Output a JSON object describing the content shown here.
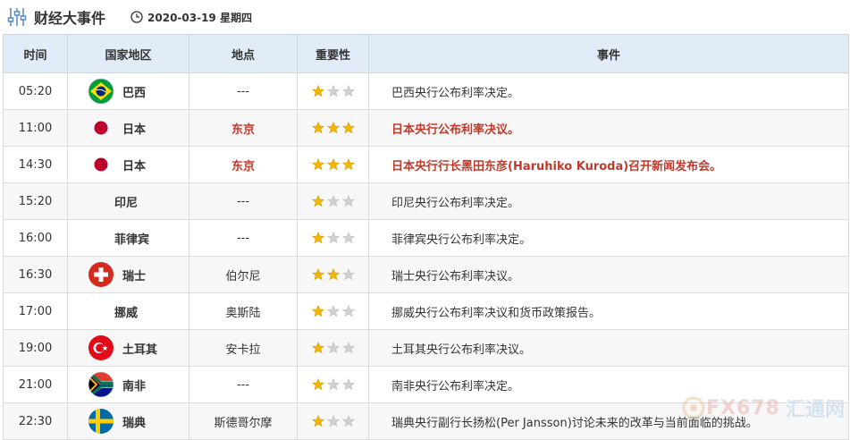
{
  "header": {
    "title": "财经大事件",
    "date": "2020-03-19 星期四"
  },
  "columns": [
    "时间",
    "国家地区",
    "地点",
    "重要性",
    "事件"
  ],
  "colors": {
    "highlight": "#c0392b",
    "star_on": "#f2b705",
    "star_off": "#d0d0d0",
    "header_bg": "#e1ecf8"
  },
  "rows": [
    {
      "time": "05:20",
      "country": "巴西",
      "flag": "brazil",
      "location": "---",
      "stars": 1,
      "event": "巴西央行公布利率决定。",
      "highlight": false
    },
    {
      "time": "11:00",
      "country": "日本",
      "flag": "japan",
      "location": "东京",
      "stars": 3,
      "event": "日本央行公布利率决议。",
      "highlight": true
    },
    {
      "time": "14:30",
      "country": "日本",
      "flag": "japan",
      "location": "东京",
      "stars": 3,
      "event": "日本央行行长黑田东彦(Haruhiko Kuroda)召开新闻发布会。",
      "highlight": true
    },
    {
      "time": "15:20",
      "country": "印尼",
      "flag": "",
      "location": "---",
      "stars": 1,
      "event": "印尼央行公布利率决定。",
      "highlight": false
    },
    {
      "time": "16:00",
      "country": "菲律宾",
      "flag": "",
      "location": "---",
      "stars": 1,
      "event": "菲律宾央行公布利率决定。",
      "highlight": false
    },
    {
      "time": "16:30",
      "country": "瑞士",
      "flag": "switzerland",
      "location": "伯尔尼",
      "stars": 2,
      "event": "瑞士央行公布利率决议。",
      "highlight": false
    },
    {
      "time": "17:00",
      "country": "挪威",
      "flag": "",
      "location": "奥斯陆",
      "stars": 1,
      "event": "挪威央行公布利率决议和货币政策报告。",
      "highlight": false
    },
    {
      "time": "19:00",
      "country": "土耳其",
      "flag": "turkey",
      "location": "安卡拉",
      "stars": 1,
      "event": "土耳其央行公布利率决议。",
      "highlight": false
    },
    {
      "time": "21:00",
      "country": "南非",
      "flag": "southafrica",
      "location": "---",
      "stars": 1,
      "event": "南非央行公布利率决定。",
      "highlight": false
    },
    {
      "time": "22:30",
      "country": "瑞典",
      "flag": "sweden",
      "location": "斯德哥尔摩",
      "stars": 1,
      "event": "瑞典央行副行长扬松(Per Jansson)讨论未来的改革与当前面临的挑战。",
      "highlight": false
    }
  ],
  "watermark": {
    "text": "FX678",
    "cn": "汇通网"
  }
}
